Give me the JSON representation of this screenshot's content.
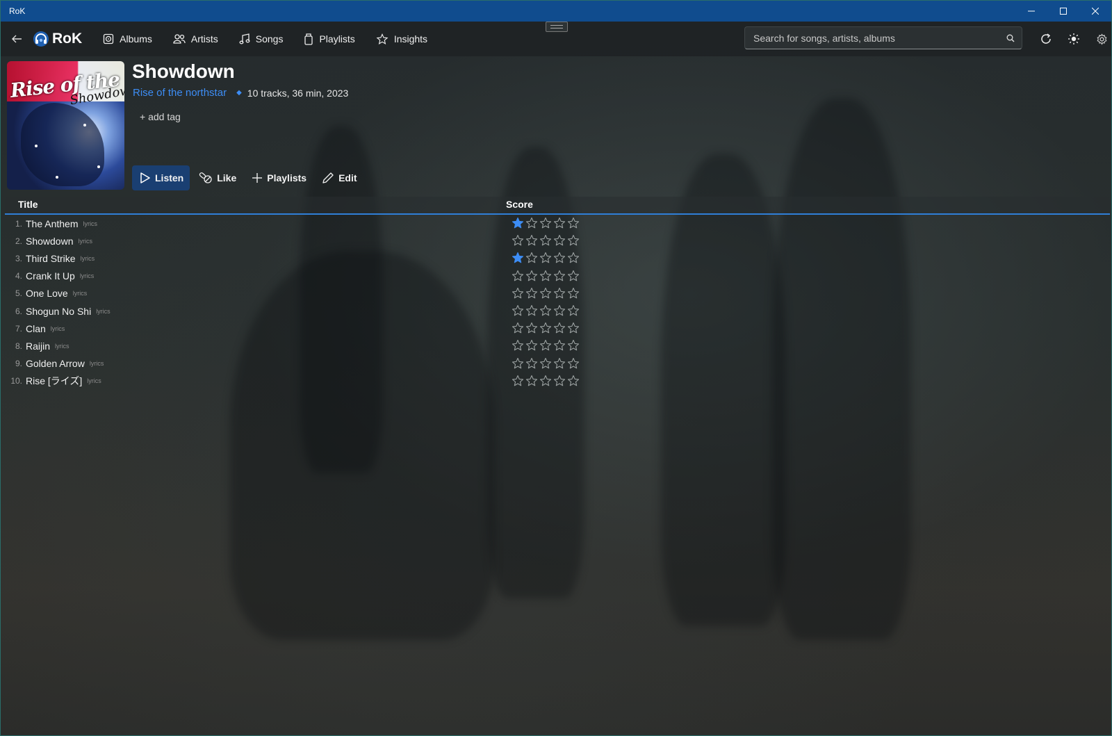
{
  "window": {
    "title": "RoK"
  },
  "nav": {
    "brand": "RoK",
    "items": [
      {
        "label": "Albums",
        "icon": "album-icon"
      },
      {
        "label": "Artists",
        "icon": "artists-icon"
      },
      {
        "label": "Songs",
        "icon": "music-note-icon"
      },
      {
        "label": "Playlists",
        "icon": "playlist-icon"
      },
      {
        "label": "Insights",
        "icon": "star-icon"
      }
    ],
    "search_placeholder": "Search for songs, artists, albums"
  },
  "album": {
    "title": "Showdown",
    "artist": "Rise of the northstar",
    "info": "10 tracks, 36 min,  2023",
    "add_tag": "+ add tag",
    "cover_text": "Rise of the northstar",
    "cover_sub": "Showdown"
  },
  "actions": {
    "listen": "Listen",
    "like": "Like",
    "playlists": "Playlists",
    "edit": "Edit"
  },
  "table": {
    "headers": {
      "title": "Title",
      "score": "Score"
    },
    "max_stars": 5,
    "lyrics_label": "lyrics",
    "tracks": [
      {
        "num": "1.",
        "title": "The Anthem",
        "score": 1
      },
      {
        "num": "2.",
        "title": "Showdown",
        "score": 0
      },
      {
        "num": "3.",
        "title": "Third Strike",
        "score": 1
      },
      {
        "num": "4.",
        "title": "Crank It Up",
        "score": 0
      },
      {
        "num": "5.",
        "title": "One Love",
        "score": 0
      },
      {
        "num": "6.",
        "title": "Shogun No Shi",
        "score": 0
      },
      {
        "num": "7.",
        "title": "Clan",
        "score": 0
      },
      {
        "num": "8.",
        "title": "Raijin",
        "score": 0
      },
      {
        "num": "9.",
        "title": "Golden Arrow",
        "score": 0
      },
      {
        "num": "10.",
        "title": "Rise [ライズ]",
        "score": 0
      }
    ]
  },
  "colors": {
    "accent": "#3d8df5",
    "titlebar": "#104c8e",
    "star_filled": "#3d8df5",
    "star_empty": "#9aa0a0"
  }
}
